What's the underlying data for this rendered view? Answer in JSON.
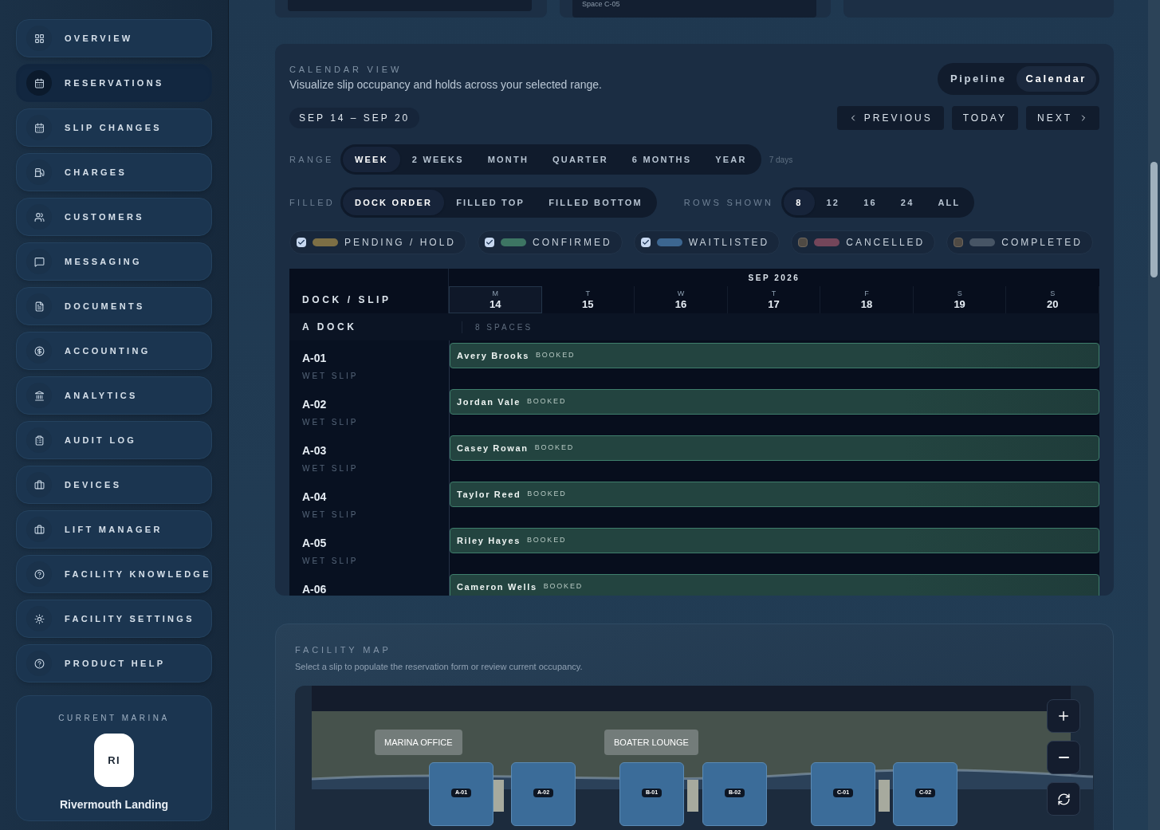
{
  "sidebar": {
    "items": [
      {
        "label": "OVERVIEW",
        "selected": false
      },
      {
        "label": "RESERVATIONS",
        "selected": true
      },
      {
        "label": "SLIP CHANGES",
        "selected": false
      },
      {
        "label": "CHARGES",
        "selected": false
      },
      {
        "label": "CUSTOMERS",
        "selected": false
      },
      {
        "label": "MESSAGING",
        "selected": false
      },
      {
        "label": "DOCUMENTS",
        "selected": false
      },
      {
        "label": "ACCOUNTING",
        "selected": false
      },
      {
        "label": "ANALYTICS",
        "selected": false
      },
      {
        "label": "AUDIT LOG",
        "selected": false
      },
      {
        "label": "DEVICES",
        "selected": false
      },
      {
        "label": "LIFT MANAGER",
        "selected": false
      },
      {
        "label": "FACILITY KNOWLEDGE",
        "selected": false
      },
      {
        "label": "FACILITY SETTINGS",
        "selected": false
      },
      {
        "label": "PRODUCT HELP",
        "selected": false
      }
    ],
    "current_marina": {
      "heading": "CURRENT MARINA",
      "initials": "RI",
      "name": "Rivermouth Landing"
    }
  },
  "top_cards": {
    "field_value": "Space C-05"
  },
  "calendar": {
    "title": "CALENDAR VIEW",
    "subtitle": "Visualize slip occupancy and holds across your selected range.",
    "view_toggle": [
      {
        "label": "Pipeline",
        "selected": false
      },
      {
        "label": "Calendar",
        "selected": true
      }
    ],
    "date_range": "SEP 14 – SEP 20",
    "nav_buttons": [
      {
        "label": "PREVIOUS",
        "kind": "prev"
      },
      {
        "label": "TODAY",
        "kind": "today"
      },
      {
        "label": "NEXT",
        "kind": "next"
      }
    ],
    "range": {
      "label": "RANGE",
      "options": [
        {
          "label": "WEEK",
          "selected": true
        },
        {
          "label": "2 WEEKS",
          "selected": false
        },
        {
          "label": "MONTH",
          "selected": false
        },
        {
          "label": "QUARTER",
          "selected": false
        },
        {
          "label": "6 MONTHS",
          "selected": false
        },
        {
          "label": "YEAR",
          "selected": false
        }
      ],
      "note": "7 days"
    },
    "filled": {
      "label": "FILLED",
      "options": [
        {
          "label": "DOCK ORDER",
          "selected": true
        },
        {
          "label": "FILLED TOP",
          "selected": false
        },
        {
          "label": "FILLED BOTTOM",
          "selected": false
        }
      ]
    },
    "rows_shown": {
      "label": "ROWS SHOWN",
      "options": [
        {
          "label": "8",
          "selected": true
        },
        {
          "label": "12",
          "selected": false
        },
        {
          "label": "16",
          "selected": false
        },
        {
          "label": "24",
          "selected": false
        },
        {
          "label": "ALL",
          "selected": false
        }
      ]
    },
    "legend": [
      {
        "label": "PENDING / HOLD",
        "checked": true,
        "color": "#7d6f45"
      },
      {
        "label": "CONFIRMED",
        "checked": true,
        "color": "#3d7563"
      },
      {
        "label": "WAITLISTED",
        "checked": true,
        "color": "#3c6690"
      },
      {
        "label": "CANCELLED",
        "checked": false,
        "color": "#74465a"
      },
      {
        "label": "COMPLETED",
        "checked": false,
        "color": "#475565"
      }
    ],
    "grid": {
      "corner": "DOCK / SLIP",
      "month": "SEP 2026",
      "days": [
        {
          "weekday": "M",
          "date": "14",
          "selected": true
        },
        {
          "weekday": "T",
          "date": "15",
          "selected": false
        },
        {
          "weekday": "W",
          "date": "16",
          "selected": false
        },
        {
          "weekday": "T",
          "date": "17",
          "selected": false
        },
        {
          "weekday": "F",
          "date": "18",
          "selected": false
        },
        {
          "weekday": "S",
          "date": "19",
          "selected": false
        },
        {
          "weekday": "S",
          "date": "20",
          "selected": false
        }
      ],
      "dock": {
        "name": "A DOCK",
        "spaces": "8 SPACES"
      },
      "rows": [
        {
          "slip": "A-01",
          "type": "WET SLIP",
          "guest": "Avery Brooks",
          "status": "BOOKED"
        },
        {
          "slip": "A-02",
          "type": "WET SLIP",
          "guest": "Jordan Vale",
          "status": "BOOKED"
        },
        {
          "slip": "A-03",
          "type": "WET SLIP",
          "guest": "Casey Rowan",
          "status": "BOOKED"
        },
        {
          "slip": "A-04",
          "type": "WET SLIP",
          "guest": "Taylor Reed",
          "status": "BOOKED"
        },
        {
          "slip": "A-05",
          "type": "WET SLIP",
          "guest": "Riley Hayes",
          "status": "BOOKED"
        },
        {
          "slip": "A-06",
          "guest": "Cameron Wells",
          "status": "BOOKED"
        }
      ]
    }
  },
  "facility_map": {
    "title": "FACILITY MAP",
    "subtitle": "Select a slip to populate the reservation form or review current occupancy.",
    "buildings": [
      {
        "label": "MARINA OFFICE"
      },
      {
        "label": "BOATER LOUNGE"
      }
    ],
    "slips": [
      {
        "label": "A-01"
      },
      {
        "label": "A-02"
      },
      {
        "label": "B-01"
      },
      {
        "label": "B-02"
      },
      {
        "label": "C-01"
      },
      {
        "label": "C-02"
      }
    ]
  }
}
